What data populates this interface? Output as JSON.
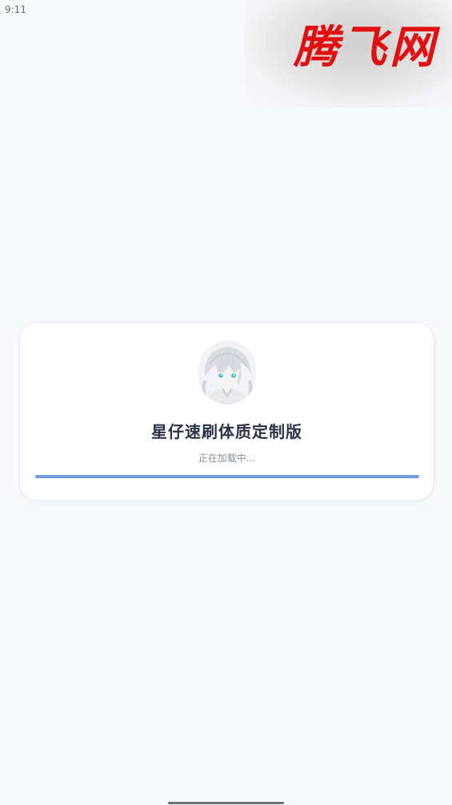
{
  "status_bar": {
    "time": "9:11",
    "icons": [
      "wifi-icon",
      "signal-icon",
      "battery-icon"
    ]
  },
  "watermark": {
    "text": "腾飞网",
    "color": "#e01010"
  },
  "loading_card": {
    "avatar": "anime-character-avatar",
    "app_title": "星仔速刷体质定制版",
    "status_text": "正在加载中...",
    "progress": 1.0,
    "progress_color": "#6f9be0"
  }
}
